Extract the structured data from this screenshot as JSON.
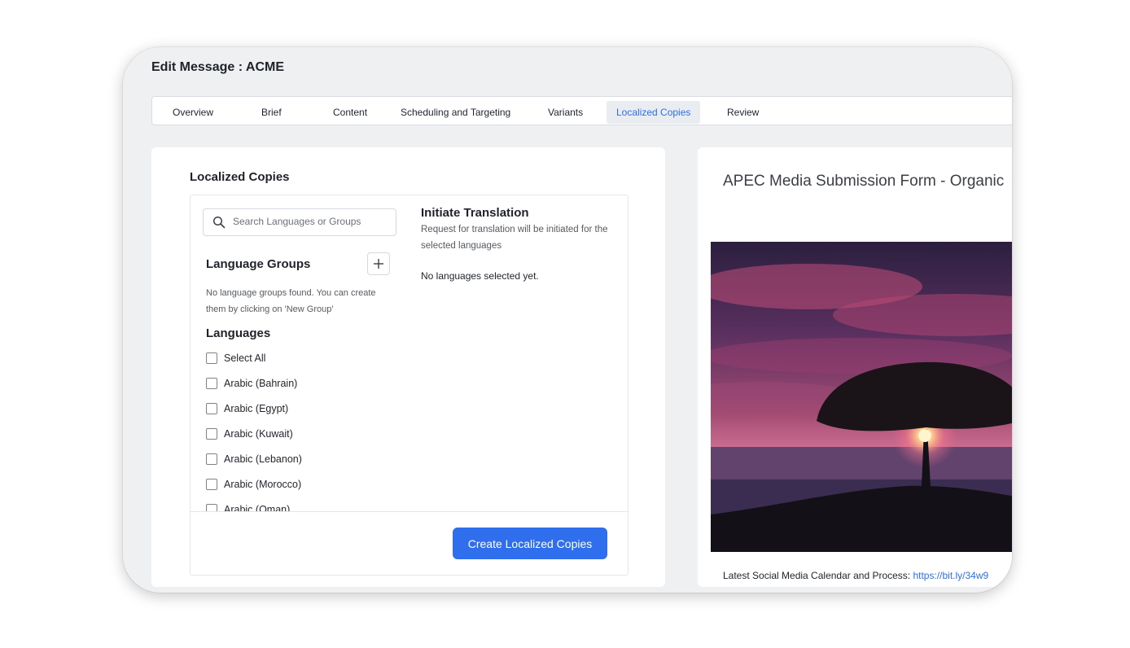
{
  "page": {
    "title": "Edit Message : ACME"
  },
  "tabs": [
    {
      "label": "Overview",
      "active": false
    },
    {
      "label": "Brief",
      "active": false
    },
    {
      "label": "Content",
      "active": false
    },
    {
      "label": "Scheduling and Targeting",
      "active": false
    },
    {
      "label": "Variants",
      "active": false
    },
    {
      "label": "Localized Copies",
      "active": true
    },
    {
      "label": "Review",
      "active": false
    }
  ],
  "localized": {
    "title": "Localized Copies",
    "search": {
      "placeholder": "Search Languages or Groups",
      "value": ""
    },
    "language_groups": {
      "title": "Language Groups",
      "empty_text": "No language groups found. You can create them by clicking on 'New Group'"
    },
    "languages": {
      "title": "Languages",
      "items": [
        {
          "label": "Select All",
          "checked": false
        },
        {
          "label": "Arabic (Bahrain)",
          "checked": false
        },
        {
          "label": "Arabic (Egypt)",
          "checked": false
        },
        {
          "label": "Arabic (Kuwait)",
          "checked": false
        },
        {
          "label": "Arabic (Lebanon)",
          "checked": false
        },
        {
          "label": "Arabic (Morocco)",
          "checked": false
        },
        {
          "label": "Arabic (Oman)",
          "checked": false
        }
      ]
    },
    "initiate": {
      "title": "Initiate Translation",
      "description": "Request for translation will be initiated for the selected languages",
      "empty_text": "No languages selected yet."
    },
    "create_button": "Create Localized Copies"
  },
  "preview": {
    "title": "APEC Media Submission Form - Organic",
    "footer_text": "Latest Social Media Calendar and Process: ",
    "footer_link": "https://bit.ly/34w9"
  },
  "colors": {
    "accent": "#2f6fed",
    "link": "#2d6fe6",
    "background": "#eef0f2"
  }
}
